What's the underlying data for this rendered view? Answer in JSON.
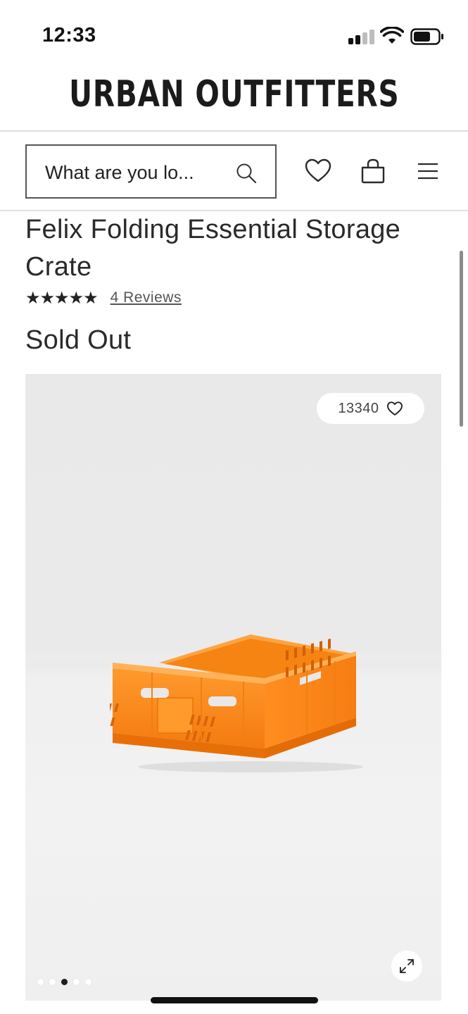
{
  "status_bar": {
    "time": "12:33"
  },
  "brand": {
    "logo_text": "URBAN OUTFITTERS"
  },
  "search": {
    "placeholder": "What are you lo..."
  },
  "nav": {
    "icons": [
      "heart-icon",
      "bag-icon",
      "menu-icon"
    ]
  },
  "product": {
    "title": "Felix Folding Essential Storage Crate",
    "rating_stars": "★★★★★",
    "rating_value": 5,
    "reviews_label": "4 Reviews",
    "price_status": "Sold Out"
  },
  "gallery": {
    "likes_count": "13340",
    "image_count": 5,
    "active_image": 3,
    "product_color": "#ff8a1c"
  },
  "colors": {
    "text": "#1f1f1f",
    "border": "#555555",
    "divider": "#dcdcdc"
  }
}
